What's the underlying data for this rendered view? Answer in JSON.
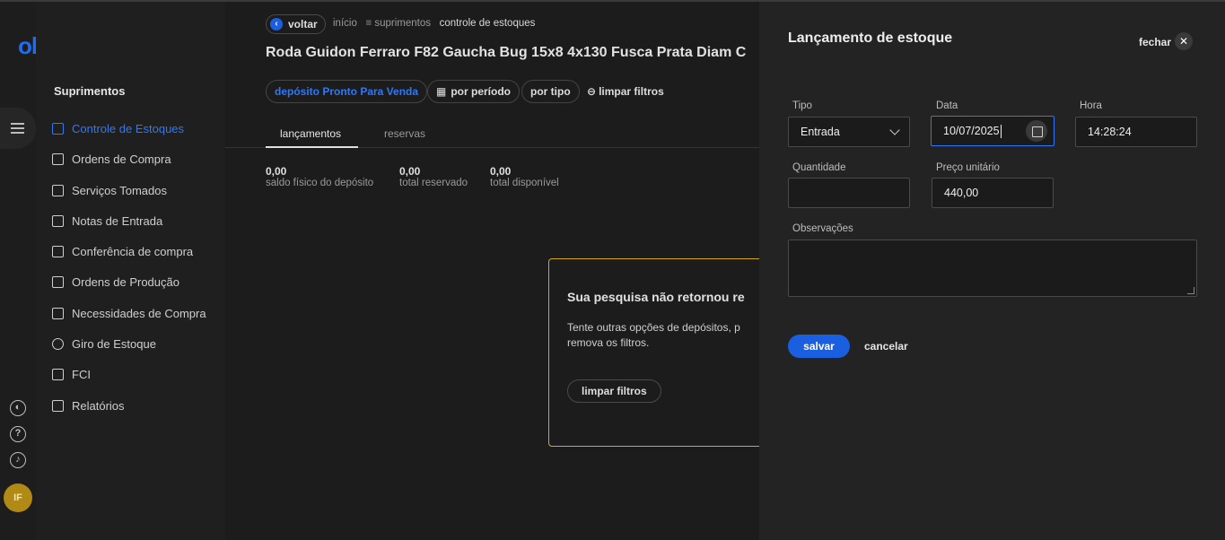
{
  "app": {
    "logo": "olist"
  },
  "rail": {
    "avatar_initials": "IF"
  },
  "sidebar": {
    "title": "Suprimentos",
    "items": [
      {
        "label": "Controle de Estoques",
        "icon": "grid-icon",
        "active": true
      },
      {
        "label": "Ordens de Compra",
        "icon": "inbox-icon"
      },
      {
        "label": "Serviços Tomados",
        "icon": "document-icon"
      },
      {
        "label": "Notas de Entrada",
        "icon": "document-icon"
      },
      {
        "label": "Conferência de compra",
        "icon": "gift-icon"
      },
      {
        "label": "Ordens de Produção",
        "icon": "plug-icon"
      },
      {
        "label": "Necessidades de Compra",
        "icon": "clipboard-icon"
      },
      {
        "label": "Giro de Estoque",
        "icon": "refresh-icon"
      },
      {
        "label": "FCI",
        "icon": "inbox-icon"
      },
      {
        "label": "Relatórios",
        "icon": "report-icon"
      }
    ]
  },
  "header": {
    "back_label": "voltar",
    "breadcrumb": {
      "home": "início",
      "section": "suprimentos",
      "current": "controle de estoques"
    },
    "title": "Roda Guidon Ferraro F82 Gaucha Bug 15x8 4x130 Fusca Prata Diam C"
  },
  "filters": {
    "deposit": "depósito Pronto Para Venda",
    "period": "por período",
    "type": "por tipo",
    "clear": "limpar filtros"
  },
  "tabs": [
    {
      "label": "lançamentos",
      "active": true
    },
    {
      "label": "reservas",
      "active": false
    }
  ],
  "stats": [
    {
      "value": "0,00",
      "label": "saldo físico do depósito"
    },
    {
      "value": "0,00",
      "label": "total reservado"
    },
    {
      "value": "0,00",
      "label": "total disponível"
    }
  ],
  "empty_state": {
    "title": "Sua pesquisa não retornou re",
    "line1": "Tente outras opções de depósitos, p",
    "line2": "remova os filtros.",
    "button": "limpar filtros"
  },
  "drawer": {
    "title": "Lançamento de estoque",
    "close_label": "fechar",
    "fields": {
      "tipo": {
        "label": "Tipo",
        "value": "Entrada"
      },
      "data": {
        "label": "Data",
        "value": "10/07/2025"
      },
      "hora": {
        "label": "Hora",
        "value": "14:28:24"
      },
      "quantidade": {
        "label": "Quantidade",
        "value": ""
      },
      "preco": {
        "label": "Preço unitário",
        "value": "440,00"
      },
      "observacoes": {
        "label": "Observações",
        "value": ""
      }
    },
    "save": "salvar",
    "cancel": "cancelar"
  },
  "colors": {
    "accent": "#1a5fe0",
    "warning_border": "#d4a81a",
    "avatar": "#b08a14"
  }
}
